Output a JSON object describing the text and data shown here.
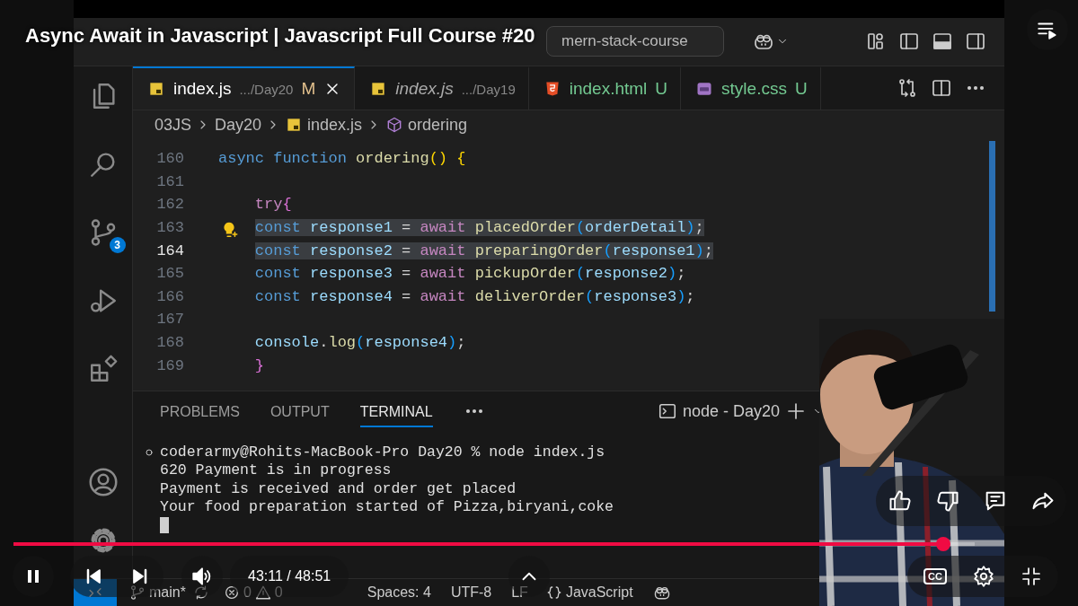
{
  "player": {
    "title": "Async Await in Javascript | Javascript Full Course #20",
    "playing": true,
    "muted": false,
    "time": "43:11 / 48:51",
    "captions_label": "CC",
    "fullscreen": true,
    "progress": {
      "level": 0.967
    }
  },
  "titlebar": {
    "search": "mern-stack-course"
  },
  "activity_bar": {
    "source_control_badge": "3"
  },
  "tabs": [
    {
      "kind": "js",
      "name": "index.js",
      "path": ".../Day20",
      "git": {
        "label": "M",
        "color": "#e2c08d"
      },
      "selected": true,
      "preview": false
    },
    {
      "kind": "js",
      "name": "index.js",
      "path": ".../Day19",
      "selected": false,
      "preview": true
    },
    {
      "kind": "html",
      "name": "index.html",
      "git": {
        "label": "U",
        "color": "#73c991"
      },
      "selected": false,
      "preview": false
    },
    {
      "kind": "css",
      "name": "style.css",
      "git": {
        "label": "U",
        "color": "#73c991"
      },
      "selected": false,
      "preview": false
    }
  ],
  "breadcrumb": [
    {
      "kind": "folder",
      "label": "03JS"
    },
    {
      "kind": "folder",
      "label": "Day20"
    },
    {
      "kind": "js",
      "label": "index.js"
    },
    {
      "kind": "symbol",
      "label": "ordering"
    }
  ],
  "code": {
    "lines": [
      {
        "number": "160",
        "selected": false,
        "current": false,
        "lightbulb": false,
        "tokens": [
          {
            "text": "async",
            "kind": "keyword"
          },
          {
            "text": " function",
            "kind": "keyword"
          },
          {
            "text": " ordering",
            "kind": "func"
          },
          {
            "text": "()",
            "kind": "bracket1"
          },
          {
            "text": " {",
            "kind": "bracket1"
          }
        ]
      },
      {
        "number": "161",
        "selected": false,
        "current": false,
        "lightbulb": false
      },
      {
        "number": "162",
        "selected": false,
        "current": false,
        "lightbulb": false,
        "tokens": [
          {
            "text": "    try",
            "kind": "control"
          },
          {
            "text": "{",
            "kind": "bracket2"
          }
        ]
      },
      {
        "number": "163",
        "selected": true,
        "current": false,
        "lightbulb": true,
        "tokens": [
          {
            "text": "    const",
            "kind": "keyword"
          },
          {
            "text": " response1",
            "kind": "var"
          },
          {
            "text": " = ",
            "kind": "plain"
          },
          {
            "text": "await",
            "kind": "control"
          },
          {
            "text": " placedOrder",
            "kind": "func"
          },
          {
            "text": "(",
            "kind": "bracket3"
          },
          {
            "text": "orderDetail",
            "kind": "var"
          },
          {
            "text": ")",
            "kind": "bracket3"
          },
          {
            "text": ";",
            "kind": "plain"
          }
        ]
      },
      {
        "number": "164",
        "selected": true,
        "current": true,
        "lightbulb": false,
        "tokens": [
          {
            "text": "    const",
            "kind": "keyword"
          },
          {
            "text": " response2",
            "kind": "var"
          },
          {
            "text": " = ",
            "kind": "plain"
          },
          {
            "text": "await",
            "kind": "control"
          },
          {
            "text": " preparingOrder",
            "kind": "func"
          },
          {
            "text": "(",
            "kind": "bracket3"
          },
          {
            "text": "response1",
            "kind": "var"
          },
          {
            "text": ")",
            "kind": "bracket3"
          },
          {
            "text": ";",
            "kind": "plain"
          }
        ]
      },
      {
        "number": "165",
        "selected": false,
        "current": false,
        "lightbulb": false,
        "tokens": [
          {
            "text": "    const",
            "kind": "keyword"
          },
          {
            "text": " response3",
            "kind": "var"
          },
          {
            "text": " = ",
            "kind": "plain"
          },
          {
            "text": "await",
            "kind": "control"
          },
          {
            "text": " pickupOrder",
            "kind": "func"
          },
          {
            "text": "(",
            "kind": "bracket3"
          },
          {
            "text": "response2",
            "kind": "var"
          },
          {
            "text": ")",
            "kind": "bracket3"
          },
          {
            "text": ";",
            "kind": "plain"
          }
        ]
      },
      {
        "number": "166",
        "selected": false,
        "current": false,
        "lightbulb": false,
        "tokens": [
          {
            "text": "    const",
            "kind": "keyword"
          },
          {
            "text": " response4",
            "kind": "var"
          },
          {
            "text": " = ",
            "kind": "plain"
          },
          {
            "text": "await",
            "kind": "control"
          },
          {
            "text": " deliverOrder",
            "kind": "func"
          },
          {
            "text": "(",
            "kind": "bracket3"
          },
          {
            "text": "response3",
            "kind": "var"
          },
          {
            "text": ")",
            "kind": "bracket3"
          },
          {
            "text": ";",
            "kind": "plain"
          }
        ]
      },
      {
        "number": "167",
        "selected": false,
        "current": false,
        "lightbulb": false
      },
      {
        "number": "168",
        "selected": false,
        "current": false,
        "lightbulb": false,
        "tokens": [
          {
            "text": "    console",
            "kind": "var"
          },
          {
            "text": ".",
            "kind": "plain"
          },
          {
            "text": "log",
            "kind": "func"
          },
          {
            "text": "(",
            "kind": "bracket3"
          },
          {
            "text": "response4",
            "kind": "var"
          },
          {
            "text": ")",
            "kind": "bracket3"
          },
          {
            "text": ";",
            "kind": "plain"
          }
        ]
      },
      {
        "number": "169",
        "selected": false,
        "current": false,
        "lightbulb": false,
        "tokens": [
          {
            "text": "    }",
            "kind": "bracket2"
          }
        ]
      }
    ]
  },
  "panel": {
    "tabs": [
      {
        "label": "PROBLEMS",
        "selected": false
      },
      {
        "label": "OUTPUT",
        "selected": false
      },
      {
        "label": "TERMINAL",
        "selected": true
      }
    ],
    "terminal_name": "node - Day20",
    "terminal_lines": [
      "coderarmy@Rohits-MacBook-Pro Day20 % node index.js",
      "620 Payment is in progress",
      "Payment is received and order get placed",
      "Your food preparation started of Pizza,biryani,coke"
    ]
  },
  "status_bar": {
    "branch": "main*",
    "errors": "0",
    "warnings": "0",
    "items": [
      "Spaces: 4",
      "UTF-8",
      "LF"
    ],
    "language": "JavaScript"
  }
}
